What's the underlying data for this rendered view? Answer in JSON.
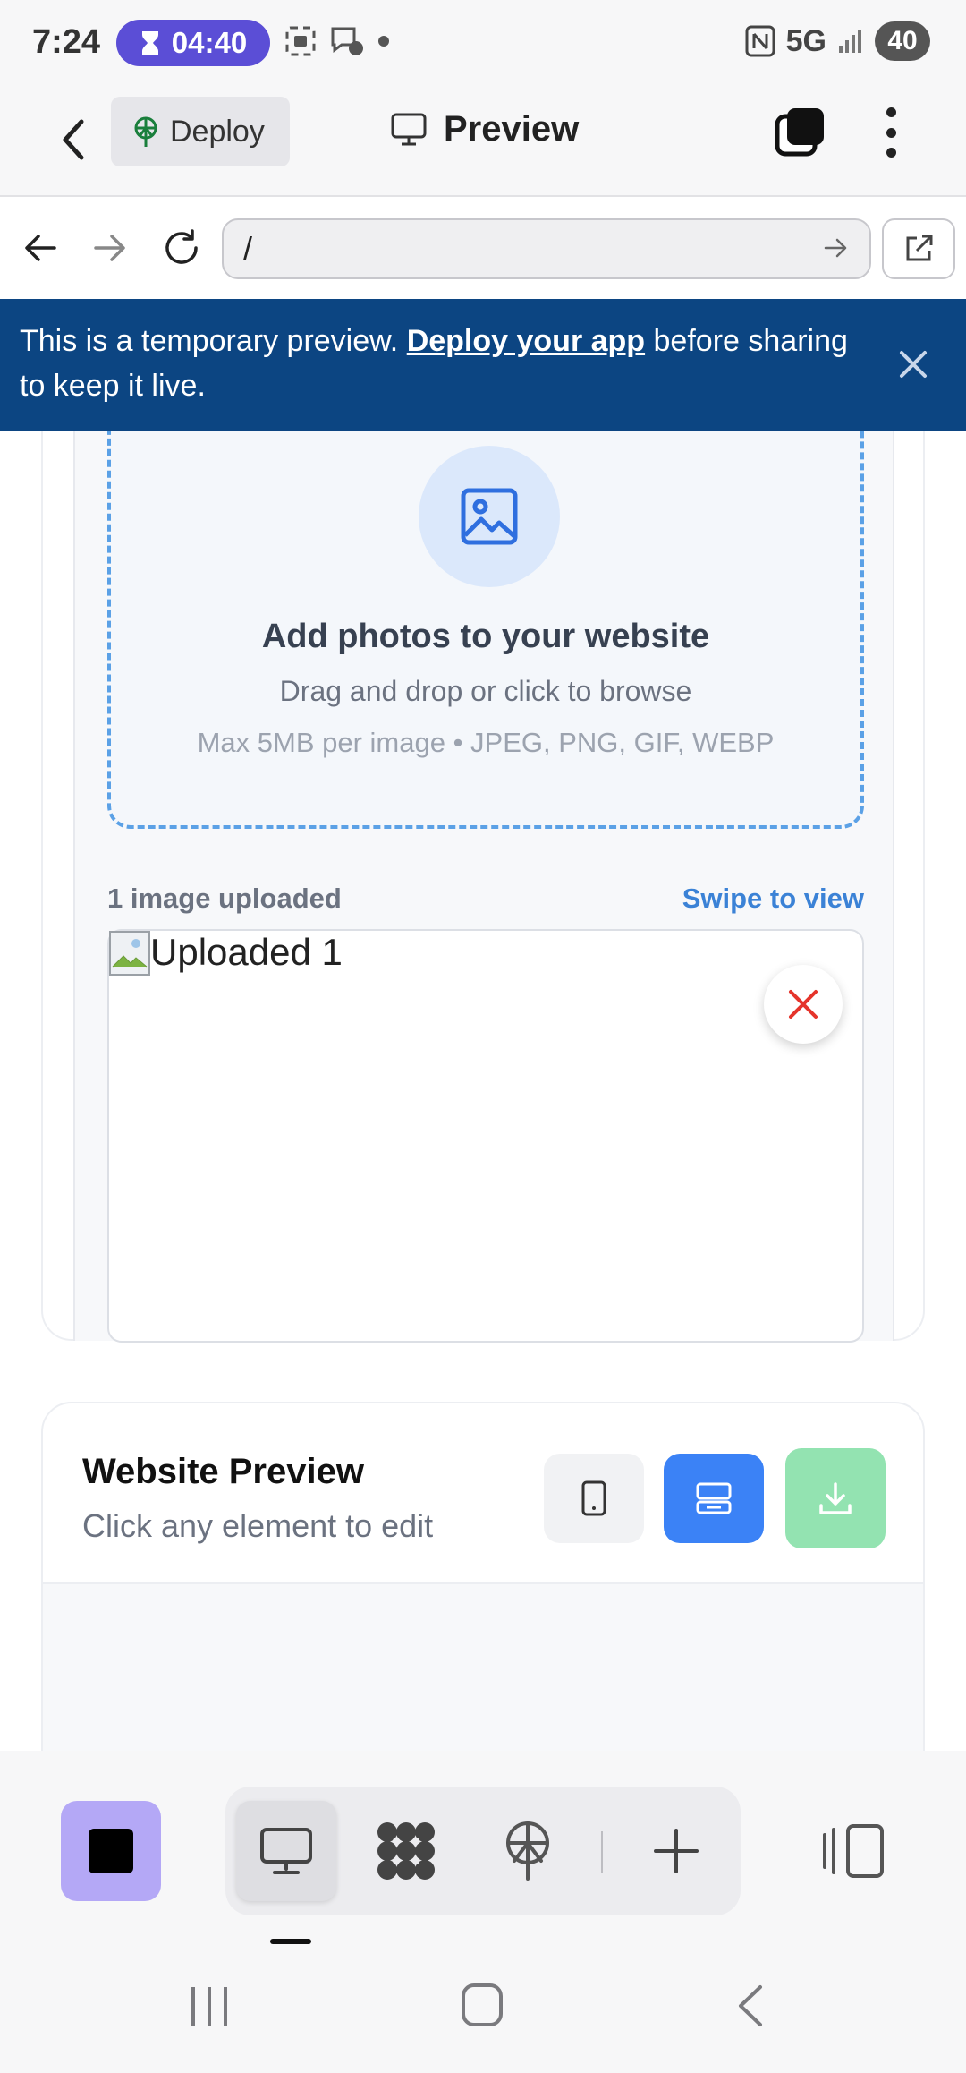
{
  "status_bar": {
    "time": "7:24",
    "timer": "04:40",
    "network": "5G",
    "battery": "40"
  },
  "header": {
    "deploy_label": "Deploy",
    "title": "Preview"
  },
  "browser": {
    "url": "/"
  },
  "banner": {
    "text_before": "This is a temporary preview. ",
    "link": "Deploy your app",
    "text_after": " before sharing to keep it live."
  },
  "upload": {
    "title": "Add photos to your website",
    "subtitle": "Drag and drop or click to browse",
    "hint": "Max 5MB per image • JPEG, PNG, GIF, WEBP",
    "count_label": "1 image uploaded",
    "swipe_label": "Swipe to view",
    "image_alt": "Uploaded 1"
  },
  "website_preview": {
    "title": "Website Preview",
    "subtitle": "Click any element to edit"
  },
  "colors": {
    "banner_bg": "#0c4582",
    "accent_blue": "#3b82f6",
    "download_green": "#93e3b1",
    "stop_purple": "#b4a8f6",
    "timer_purple": "#5b4ed6",
    "remove_red": "#e5342b"
  },
  "icons": {
    "toolbar": [
      "stop-icon",
      "desktop-icon",
      "apps-icon",
      "deploy-icon",
      "plus-icon",
      "panel-icon"
    ]
  }
}
